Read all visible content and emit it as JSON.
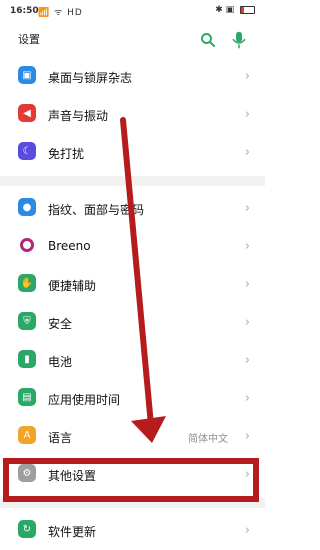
{
  "status_bar": {
    "time": "16:50",
    "left_icons": "📶 ᯤ HD",
    "right_icons": "✱ ▣"
  },
  "app_bar": {
    "title": "设置",
    "search_icon": "search-icon",
    "mic_icon": "mic-icon",
    "accent_color": "#2aa868"
  },
  "groups": [
    {
      "items": [
        {
          "label": "桌面与锁屏杂志",
          "icon": "wallpaper-icon",
          "color": "#2b8ae6"
        },
        {
          "label": "声音与振动",
          "icon": "sound-icon",
          "color": "#e53935"
        },
        {
          "label": "免打扰",
          "icon": "moon-icon",
          "color": "#5b4be1"
        }
      ]
    },
    {
      "items": [
        {
          "label": "指纹、面部与密码",
          "icon": "user-lock-icon",
          "color": "#2b8ae6"
        },
        {
          "label": "Breeno",
          "icon": "breeno-icon",
          "color": "#b4247d"
        },
        {
          "label": "便捷辅助",
          "icon": "hand-icon",
          "color": "#2aa868"
        },
        {
          "label": "安全",
          "icon": "shield-icon",
          "color": "#2aa868"
        },
        {
          "label": "电池",
          "icon": "battery-icon",
          "color": "#2aa868"
        },
        {
          "label": "应用使用时间",
          "icon": "app-usage-icon",
          "color": "#2aa868"
        },
        {
          "label": "语言",
          "icon": "language-icon",
          "color": "#f2a32a",
          "value": "简体中文"
        },
        {
          "label": "其他设置",
          "icon": "gear-icon",
          "color": "#9e9e9e"
        }
      ]
    },
    {
      "items": [
        {
          "label": "软件更新",
          "icon": "update-icon",
          "color": "#2aa868"
        }
      ]
    }
  ]
}
